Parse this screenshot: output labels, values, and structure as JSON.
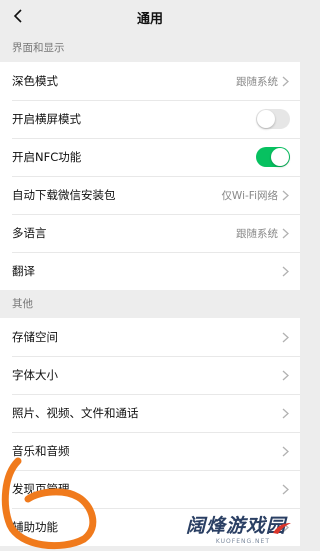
{
  "nav": {
    "title": "通用"
  },
  "sections": [
    {
      "header": "界面和显示",
      "rows": [
        {
          "label": "深色模式",
          "value": "跟随系统",
          "type": "chevron"
        },
        {
          "label": "开启横屏模式",
          "type": "toggle",
          "on": false
        },
        {
          "label": "开启NFC功能",
          "type": "toggle",
          "on": true
        },
        {
          "label": "自动下载微信安装包",
          "value": "仅Wi-Fi网络",
          "type": "chevron"
        },
        {
          "label": "多语言",
          "value": "跟随系统",
          "type": "chevron"
        },
        {
          "label": "翻译",
          "value": "",
          "type": "chevron"
        }
      ]
    },
    {
      "header": "其他",
      "rows": [
        {
          "label": "存储空间",
          "type": "chevron"
        },
        {
          "label": "字体大小",
          "type": "chevron"
        },
        {
          "label": "照片、视频、文件和通话",
          "type": "chevron"
        },
        {
          "label": "音乐和音频",
          "type": "chevron"
        },
        {
          "label": "发现页管理",
          "type": "chevron"
        },
        {
          "label": "辅助功能",
          "type": "chevron"
        }
      ]
    }
  ],
  "colors": {
    "toggle_on": "#07c160",
    "toggle_off": "#e6e6e6",
    "annotation": "#f07a1c"
  },
  "watermark": {
    "main": "阔烽游戏园",
    "sub": "KUOFENG.NET"
  }
}
